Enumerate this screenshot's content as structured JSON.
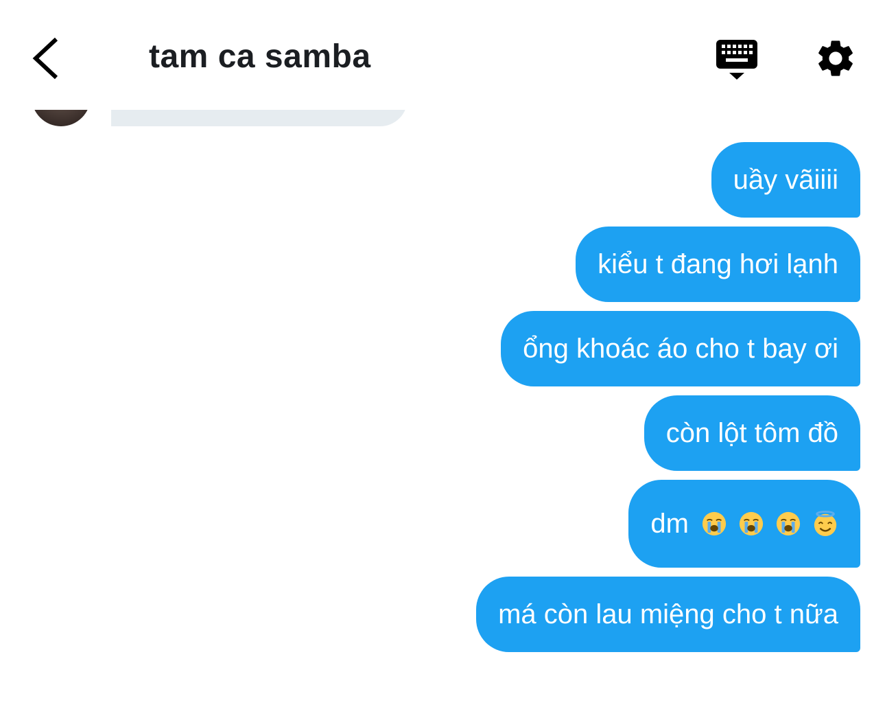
{
  "header": {
    "back_icon": "chevron-left-icon",
    "title": "tam ca samba",
    "keyboard_icon": "keyboard-icon",
    "settings_icon": "gear-icon"
  },
  "colors": {
    "sent_bubble": "#1da1f2",
    "received_bubble": "#e6ecf0",
    "title_text": "#1b1e22",
    "icon": "#000000"
  },
  "messages": [
    {
      "text": "uầy vãiiii"
    },
    {
      "text": "kiểu t đang hơi lạnh"
    },
    {
      "text": "ổng khoác áo cho t bay ơi"
    },
    {
      "text": "còn lột tôm đồ"
    },
    {
      "text": "dm",
      "emojis": [
        "loudly-crying-face-emoji",
        "loudly-crying-face-emoji",
        "loudly-crying-face-emoji",
        "smiling-face-with-halo-emoji"
      ]
    },
    {
      "text": "má còn lau miệng cho t nữa"
    }
  ]
}
